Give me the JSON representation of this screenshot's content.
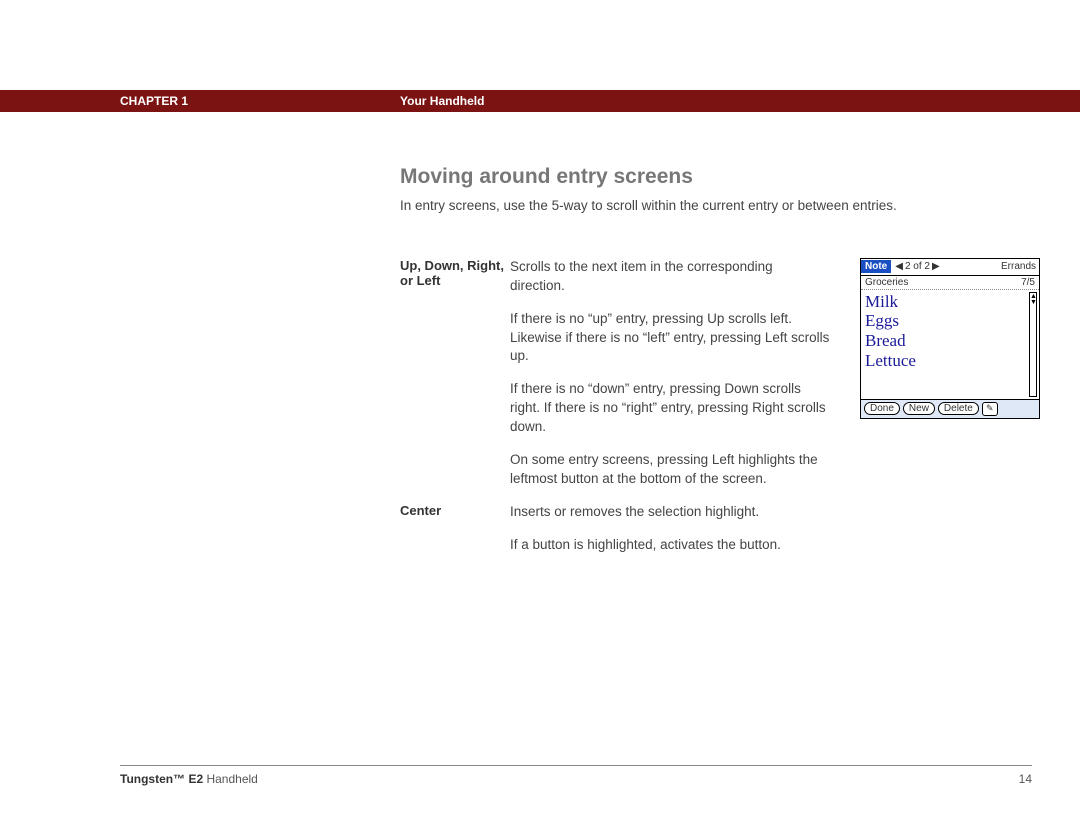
{
  "header": {
    "chapter": "CHAPTER 1",
    "section": "Your Handheld"
  },
  "main": {
    "title": "Moving around entry screens",
    "intro": "In entry screens, use the 5-way to scroll within the current entry or between entries.",
    "rows": [
      {
        "label": "Up, Down, Right, or Left",
        "paras": [
          "Scrolls to the next item in the corresponding direction.",
          "If there is no “up” entry, pressing Up scrolls left. Likewise if there is no “left” entry, pressing Left scrolls up.",
          "If there is no “down” entry, pressing Down scrolls right. If there is no “right” entry, pressing Right scrolls down.",
          "On some entry screens, pressing Left highlights the leftmost button at the bottom of the screen."
        ]
      },
      {
        "label": "Center",
        "paras": [
          "Inserts or removes the selection highlight.",
          "If a button is highlighted, activates the button."
        ]
      }
    ]
  },
  "device": {
    "app": "Note",
    "nav_left": "◀",
    "nav_text": "2 of 2",
    "nav_right": "▶",
    "category": "Errands",
    "note_title": "Groceries",
    "note_date": "7/5",
    "lines": [
      "Milk",
      "Eggs",
      "Bread",
      "Lettuce"
    ],
    "buttons": {
      "done": "Done",
      "new": "New",
      "delete": "Delete"
    },
    "pen_glyph": "✎"
  },
  "footer": {
    "product_bold": "Tungsten™ E2",
    "product_rest": " Handheld",
    "page": "14"
  }
}
